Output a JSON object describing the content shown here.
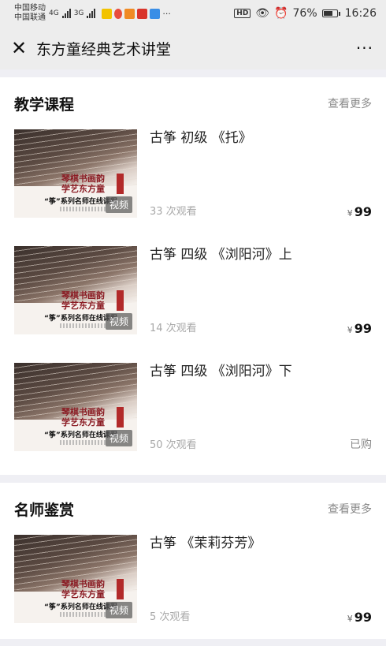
{
  "status_bar": {
    "carrier1": "中国移动",
    "carrier2": "中国联通",
    "net1": "4G",
    "net2": "3G",
    "hd": "HD",
    "battery_pct": "76%",
    "battery_level": 0.76,
    "time": "16:26"
  },
  "nav": {
    "close_symbol": "✕",
    "title": "东方童经典艺术讲堂",
    "more_symbol": "···"
  },
  "thumb": {
    "badge": "视频",
    "calligraphy": "琴棋书画韵\n学艺东方童",
    "caption": "“筝”系列名师在线课程"
  },
  "teaching": {
    "title": "教学课程",
    "more": "查看更多",
    "courses": [
      {
        "title": "古筝 初级 《托》",
        "views": "33 次观看",
        "currency": "¥",
        "price": "99"
      },
      {
        "title": "古筝 四级 《浏阳河》上",
        "views": "14 次观看",
        "currency": "¥",
        "price": "99"
      },
      {
        "title": "古筝 四级 《浏阳河》下",
        "views": "50 次观看",
        "status": "已购"
      }
    ]
  },
  "masters": {
    "title": "名师鉴赏",
    "more": "查看更多",
    "courses": [
      {
        "title": "古筝 《茉莉芬芳》",
        "views": "5 次观看",
        "currency": "¥",
        "price": "99"
      }
    ]
  }
}
